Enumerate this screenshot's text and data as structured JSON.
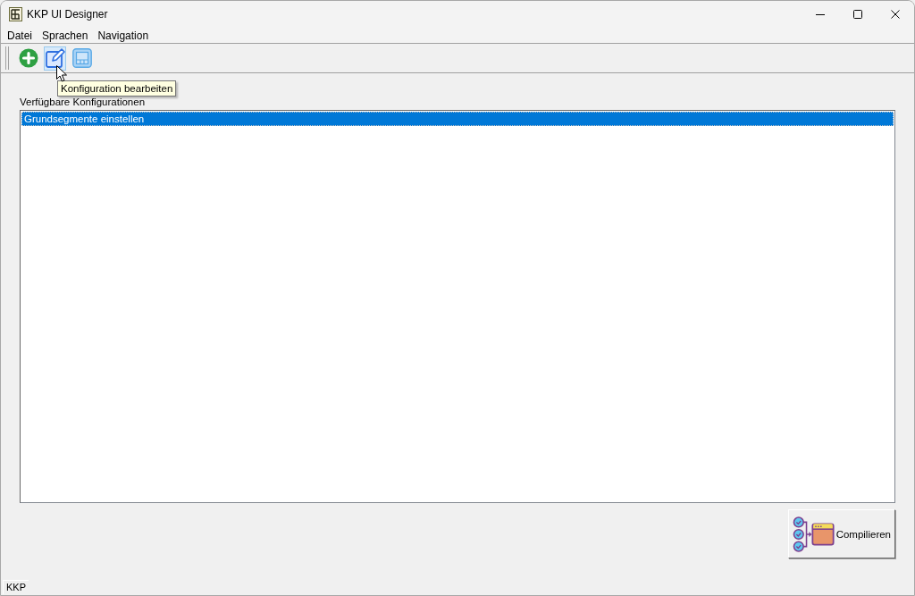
{
  "window": {
    "title": "KKP UI Designer"
  },
  "menu": [
    "Datei",
    "Sprachen",
    "Navigation"
  ],
  "toolbar": [
    {
      "kind": "add",
      "hovered": false
    },
    {
      "kind": "edit",
      "hovered": true
    },
    {
      "kind": "layout",
      "hovered": false
    }
  ],
  "tooltip": {
    "text": "Konfiguration bearbeiten"
  },
  "configurations": {
    "label": "Verfügbare Konfigurationen",
    "items": [
      {
        "label": "Grundsegmente einstellen",
        "selected": true
      }
    ]
  },
  "compile_button": {
    "label": "Compilieren"
  },
  "status_bar": {
    "text": "KKP"
  }
}
